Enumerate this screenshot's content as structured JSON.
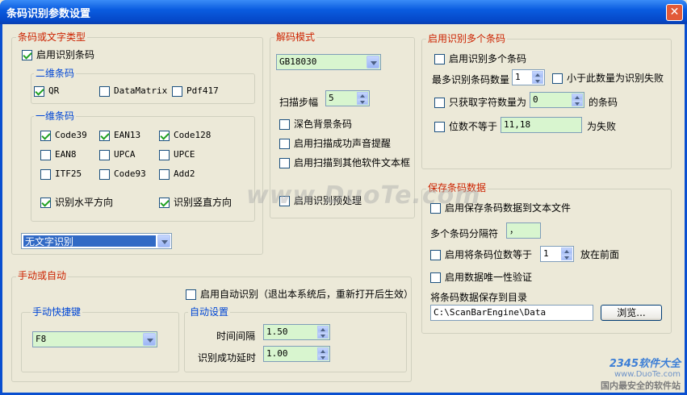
{
  "window": {
    "title": "条码识别参数设置",
    "close": "✕"
  },
  "barcode_type": {
    "title": "条码或文字类型",
    "enable_barcode": "启用识别条码",
    "twod": {
      "title": "二维条码",
      "items": [
        "QR",
        "DataMatrix",
        "Pdf417"
      ]
    },
    "oned": {
      "title": "一维条码",
      "items": [
        "Code39",
        "EAN13",
        "Code128",
        "EAN8",
        "UPCA",
        "UPCE",
        "ITF25",
        "Code93",
        "Add2"
      ],
      "horizontal": "识别水平方向",
      "vertical": "识别竖直方向"
    },
    "text_mode": "无文字识别"
  },
  "decode": {
    "title": "解码模式",
    "mode": "GB18030",
    "scan_step_label": "扫描步幅",
    "scan_step": "5",
    "dark_bg": "深色背景条码",
    "beep": "启用扫描成功声音提醒",
    "to_textbox": "启用扫描到其他软件文本框",
    "preprocess": "启用识别预处理"
  },
  "multi": {
    "title": "启用识别多个条码",
    "enable": "启用识别多个条码",
    "max_label": "最多识别条码数量",
    "max_value": "1",
    "fail_less": "小于此数量为识别失败",
    "only_len_label": "只获取字符数量为",
    "only_len_value": "0",
    "only_len_suffix": "的条码",
    "digits_ne_label": "位数不等于",
    "digits_ne_value": "11,18",
    "digits_ne_suffix": "为失败"
  },
  "save": {
    "title": "保存条码数据",
    "enable": "启用保存条码数据到文本文件",
    "sep_label": "多个条码分隔符",
    "sep_value": "，",
    "digits_eq_label": "启用将条码位数等于",
    "digits_eq_value": "1",
    "digits_eq_suffix": "放在前面",
    "unique": "启用数据唯一性验证",
    "dir_label": "将条码数据保存到目录",
    "dir_value": "C:\\ScanBarEngine\\Data",
    "browse": "浏览..."
  },
  "manual": {
    "title": "手动或自动",
    "auto_label": "启用自动识别（退出本系统后，重新打开后生效）",
    "hotkey_title": "手动快捷键",
    "hotkey": "F8",
    "auto_title": "自动设置",
    "interval_label": "时间间隔",
    "interval": "1.50",
    "delay_label": "识别成功延时",
    "delay": "1.00"
  },
  "watermark": {
    "site": "www.DuoTe.com",
    "logo_num": "2345软件大全",
    "logo_site": "www.DuoTe.com",
    "logo_slogan": "国内最安全的软件站"
  }
}
